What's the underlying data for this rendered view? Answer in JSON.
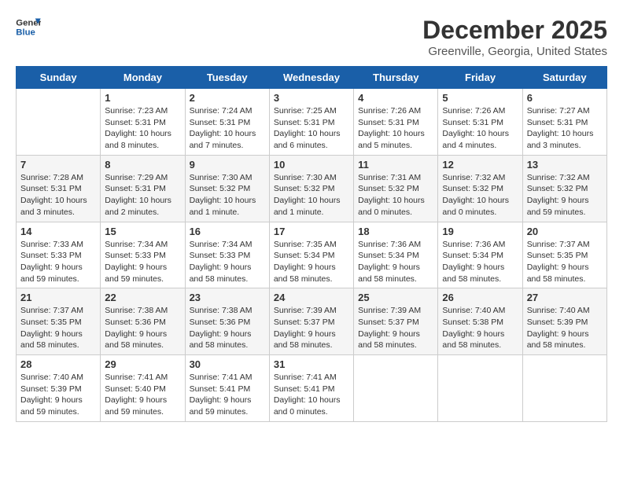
{
  "logo": {
    "line1": "General",
    "line2": "Blue"
  },
  "title": "December 2025",
  "location": "Greenville, Georgia, United States",
  "weekdays": [
    "Sunday",
    "Monday",
    "Tuesday",
    "Wednesday",
    "Thursday",
    "Friday",
    "Saturday"
  ],
  "weeks": [
    [
      {
        "day": "",
        "info": ""
      },
      {
        "day": "1",
        "info": "Sunrise: 7:23 AM\nSunset: 5:31 PM\nDaylight: 10 hours\nand 8 minutes."
      },
      {
        "day": "2",
        "info": "Sunrise: 7:24 AM\nSunset: 5:31 PM\nDaylight: 10 hours\nand 7 minutes."
      },
      {
        "day": "3",
        "info": "Sunrise: 7:25 AM\nSunset: 5:31 PM\nDaylight: 10 hours\nand 6 minutes."
      },
      {
        "day": "4",
        "info": "Sunrise: 7:26 AM\nSunset: 5:31 PM\nDaylight: 10 hours\nand 5 minutes."
      },
      {
        "day": "5",
        "info": "Sunrise: 7:26 AM\nSunset: 5:31 PM\nDaylight: 10 hours\nand 4 minutes."
      },
      {
        "day": "6",
        "info": "Sunrise: 7:27 AM\nSunset: 5:31 PM\nDaylight: 10 hours\nand 3 minutes."
      }
    ],
    [
      {
        "day": "7",
        "info": "Sunrise: 7:28 AM\nSunset: 5:31 PM\nDaylight: 10 hours\nand 3 minutes."
      },
      {
        "day": "8",
        "info": "Sunrise: 7:29 AM\nSunset: 5:31 PM\nDaylight: 10 hours\nand 2 minutes."
      },
      {
        "day": "9",
        "info": "Sunrise: 7:30 AM\nSunset: 5:32 PM\nDaylight: 10 hours\nand 1 minute."
      },
      {
        "day": "10",
        "info": "Sunrise: 7:30 AM\nSunset: 5:32 PM\nDaylight: 10 hours\nand 1 minute."
      },
      {
        "day": "11",
        "info": "Sunrise: 7:31 AM\nSunset: 5:32 PM\nDaylight: 10 hours\nand 0 minutes."
      },
      {
        "day": "12",
        "info": "Sunrise: 7:32 AM\nSunset: 5:32 PM\nDaylight: 10 hours\nand 0 minutes."
      },
      {
        "day": "13",
        "info": "Sunrise: 7:32 AM\nSunset: 5:32 PM\nDaylight: 9 hours\nand 59 minutes."
      }
    ],
    [
      {
        "day": "14",
        "info": "Sunrise: 7:33 AM\nSunset: 5:33 PM\nDaylight: 9 hours\nand 59 minutes."
      },
      {
        "day": "15",
        "info": "Sunrise: 7:34 AM\nSunset: 5:33 PM\nDaylight: 9 hours\nand 59 minutes."
      },
      {
        "day": "16",
        "info": "Sunrise: 7:34 AM\nSunset: 5:33 PM\nDaylight: 9 hours\nand 58 minutes."
      },
      {
        "day": "17",
        "info": "Sunrise: 7:35 AM\nSunset: 5:34 PM\nDaylight: 9 hours\nand 58 minutes."
      },
      {
        "day": "18",
        "info": "Sunrise: 7:36 AM\nSunset: 5:34 PM\nDaylight: 9 hours\nand 58 minutes."
      },
      {
        "day": "19",
        "info": "Sunrise: 7:36 AM\nSunset: 5:34 PM\nDaylight: 9 hours\nand 58 minutes."
      },
      {
        "day": "20",
        "info": "Sunrise: 7:37 AM\nSunset: 5:35 PM\nDaylight: 9 hours\nand 58 minutes."
      }
    ],
    [
      {
        "day": "21",
        "info": "Sunrise: 7:37 AM\nSunset: 5:35 PM\nDaylight: 9 hours\nand 58 minutes."
      },
      {
        "day": "22",
        "info": "Sunrise: 7:38 AM\nSunset: 5:36 PM\nDaylight: 9 hours\nand 58 minutes."
      },
      {
        "day": "23",
        "info": "Sunrise: 7:38 AM\nSunset: 5:36 PM\nDaylight: 9 hours\nand 58 minutes."
      },
      {
        "day": "24",
        "info": "Sunrise: 7:39 AM\nSunset: 5:37 PM\nDaylight: 9 hours\nand 58 minutes."
      },
      {
        "day": "25",
        "info": "Sunrise: 7:39 AM\nSunset: 5:37 PM\nDaylight: 9 hours\nand 58 minutes."
      },
      {
        "day": "26",
        "info": "Sunrise: 7:40 AM\nSunset: 5:38 PM\nDaylight: 9 hours\nand 58 minutes."
      },
      {
        "day": "27",
        "info": "Sunrise: 7:40 AM\nSunset: 5:39 PM\nDaylight: 9 hours\nand 58 minutes."
      }
    ],
    [
      {
        "day": "28",
        "info": "Sunrise: 7:40 AM\nSunset: 5:39 PM\nDaylight: 9 hours\nand 59 minutes."
      },
      {
        "day": "29",
        "info": "Sunrise: 7:41 AM\nSunset: 5:40 PM\nDaylight: 9 hours\nand 59 minutes."
      },
      {
        "day": "30",
        "info": "Sunrise: 7:41 AM\nSunset: 5:41 PM\nDaylight: 9 hours\nand 59 minutes."
      },
      {
        "day": "31",
        "info": "Sunrise: 7:41 AM\nSunset: 5:41 PM\nDaylight: 10 hours\nand 0 minutes."
      },
      {
        "day": "",
        "info": ""
      },
      {
        "day": "",
        "info": ""
      },
      {
        "day": "",
        "info": ""
      }
    ]
  ]
}
